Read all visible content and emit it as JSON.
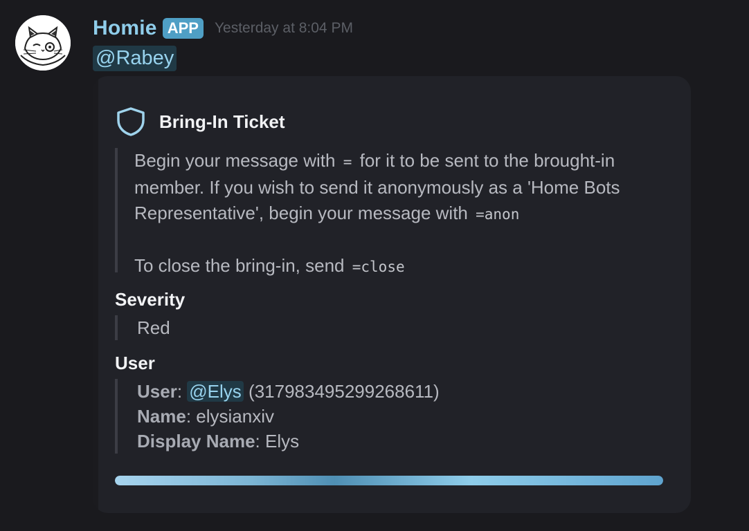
{
  "author": {
    "avatar_icon": "cat-with-glasses-avatar",
    "username": "Homie",
    "badge": "APP",
    "timestamp": "Yesterday at 8:04 PM",
    "name_color": "#8fcdea"
  },
  "message": {
    "mention": "@Rabey"
  },
  "embed": {
    "icon": "shield-icon",
    "title": "Bring-In Ticket",
    "description": {
      "line1_pre": "Begin your message with",
      "line1_code": "=",
      "line1_post": "for it to be sent to the brought-in member. If you wish to send it anonymously as a 'Home Bots Representative', begin your message with",
      "line1_code2": "=anon",
      "line2_pre": "To close the bring-in, send",
      "line2_code": "=close"
    },
    "fields": {
      "severity": {
        "name": "Severity",
        "value": "Red"
      },
      "user": {
        "name": "User",
        "user_label": "User",
        "user_mention": "@Elys",
        "user_id": "(317983495299268611)",
        "name_label": "Name",
        "name_value": "elysianxiv",
        "display_label": "Display Name",
        "display_value": "Elys"
      }
    },
    "progress": {
      "fill_fraction": 1.0
    }
  }
}
